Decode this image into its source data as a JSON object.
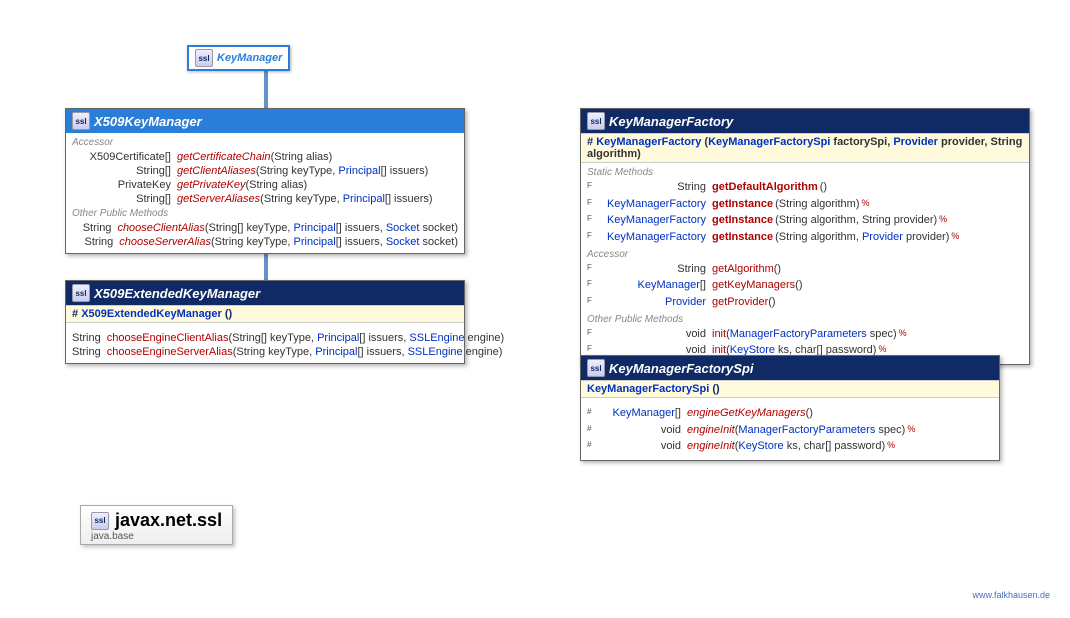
{
  "ssl_label": "ssl",
  "keyManager": {
    "name": "KeyManager"
  },
  "x509": {
    "name": "X509KeyManager",
    "section_accessor": "Accessor",
    "rows_acc": [
      {
        "ret": "X509Certificate[]",
        "name": "getCertificateChain",
        "args": "(String alias)"
      },
      {
        "ret": "String[]",
        "name": "getClientAliases",
        "args_parts": [
          "(String keyType, ",
          "Principal",
          "[] issuers)"
        ]
      },
      {
        "ret": "PrivateKey",
        "name": "getPrivateKey",
        "args": "(String alias)"
      },
      {
        "ret": "String[]",
        "name": "getServerAliases",
        "args_parts": [
          "(String keyType, ",
          "Principal",
          "[] issuers)"
        ]
      }
    ],
    "section_other": "Other Public Methods",
    "rows_other": [
      {
        "ret": "String",
        "name": "chooseClientAlias",
        "args_parts": [
          "(String[] keyType, ",
          "Principal",
          "[] issuers, ",
          "Socket",
          " socket)"
        ]
      },
      {
        "ret": "String",
        "name": "chooseServerAlias",
        "args_parts": [
          "(String keyType, ",
          "Principal",
          "[] issuers, ",
          "Socket",
          " socket)"
        ]
      }
    ]
  },
  "x509ext": {
    "name": "X509ExtendedKeyManager",
    "constructor_prefix": "#",
    "constructor": "X509ExtendedKeyManager",
    "constructor_args": " ()",
    "rows": [
      {
        "ret": "String",
        "name": "chooseEngineClientAlias",
        "args_parts": [
          "(String[] keyType, ",
          "Principal",
          "[] issuers, ",
          "SSLEngine",
          " engine)"
        ]
      },
      {
        "ret": "String",
        "name": "chooseEngineServerAlias",
        "args_parts": [
          "(String keyType, ",
          "Principal",
          "[] issuers, ",
          "SSLEngine",
          " engine)"
        ]
      }
    ]
  },
  "factory": {
    "name": "KeyManagerFactory",
    "constructor_prefix": "#",
    "constructor": "KeyManagerFactory",
    "constructor_args_parts": [
      " (",
      "KeyManagerFactorySpi",
      " factorySpi, ",
      "Provider",
      " provider, String algorithm)"
    ],
    "section_static": "Static Methods",
    "rows_static": [
      {
        "mod": "F",
        "ret": "String",
        "name": "getDefaultAlgorithm",
        "args": " ()"
      },
      {
        "mod": "F",
        "ret_link": "KeyManagerFactory",
        "name": "getInstance",
        "args": "(String algorithm)",
        "throw": "%"
      },
      {
        "mod": "F",
        "ret_link": "KeyManagerFactory",
        "name": "getInstance",
        "args": "(String algorithm, String provider)",
        "throw": "%"
      },
      {
        "mod": "F",
        "ret_link": "KeyManagerFactory",
        "name": "getInstance",
        "args_parts": [
          "(String algorithm, ",
          "Provider",
          " provider)"
        ],
        "throw": "%"
      }
    ],
    "section_accessor": "Accessor",
    "rows_acc": [
      {
        "mod": "F",
        "ret": "String",
        "name": "getAlgorithm",
        "args": " ()"
      },
      {
        "mod": "F",
        "ret_link": "KeyManager",
        "ret_suffix": "[]",
        "name": "getKeyManagers",
        "args": " ()"
      },
      {
        "mod": "F",
        "ret_link": "Provider",
        "name": "getProvider",
        "args": " ()"
      }
    ],
    "section_other": "Other Public Methods",
    "rows_other": [
      {
        "mod": "F",
        "ret": "void",
        "name": "init",
        "args_parts": [
          "(",
          "ManagerFactoryParameters",
          " spec)"
        ],
        "throw": "%"
      },
      {
        "mod": "F",
        "ret": "void",
        "name": "init",
        "args_parts": [
          "(",
          "KeyStore",
          " ks, char[] password)"
        ],
        "throw": "%"
      }
    ]
  },
  "spi": {
    "name": "KeyManagerFactorySpi",
    "constructor": "KeyManagerFactorySpi",
    "constructor_args": " ()",
    "rows": [
      {
        "mod": "#",
        "ret_link": "KeyManager",
        "ret_suffix": "[]",
        "name": "engineGetKeyManagers",
        "args": " ()"
      },
      {
        "mod": "#",
        "ret": "void",
        "name": "engineInit",
        "args_parts": [
          "(",
          "ManagerFactoryParameters",
          " spec)"
        ],
        "throw": "%"
      },
      {
        "mod": "#",
        "ret": "void",
        "name": "engineInit",
        "args_parts": [
          "(",
          "KeyStore",
          " ks, char[] password)"
        ],
        "throw": "%"
      }
    ]
  },
  "package": {
    "name": "javax.net.ssl",
    "module": "java.base"
  },
  "footer": "www.falkhausen.de"
}
